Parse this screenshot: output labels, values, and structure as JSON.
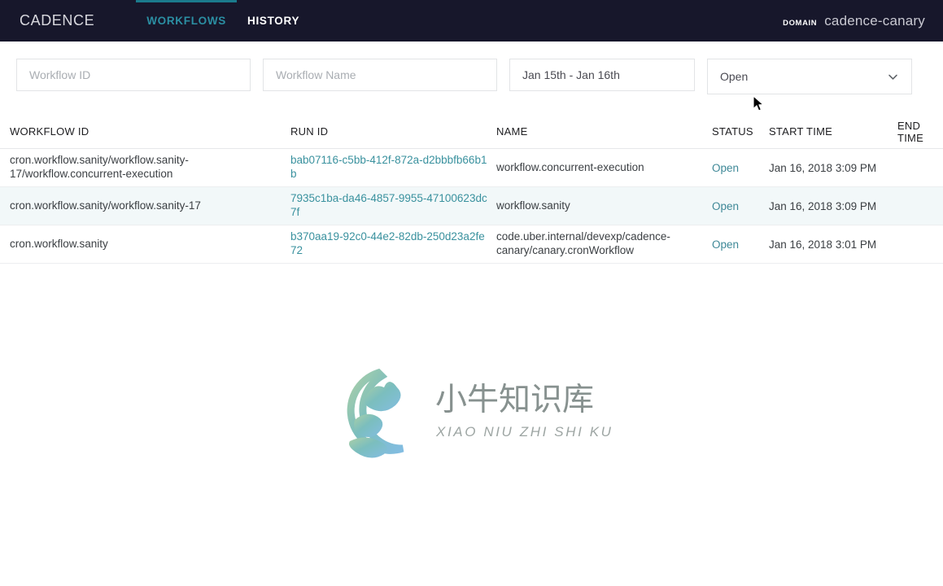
{
  "header": {
    "brand": "CADENCE",
    "tabs": [
      {
        "label": "WORKFLOWS",
        "active": true
      },
      {
        "label": "HISTORY",
        "active": false
      }
    ],
    "domain_label": "DOMAIN",
    "domain_value": "cadence-canary",
    "background_color": "#17172b",
    "active_tab_color": "#2b8fa3"
  },
  "filters": {
    "workflow_id": {
      "value": "",
      "placeholder": "Workflow ID"
    },
    "workflow_name": {
      "value": "",
      "placeholder": "Workflow Name"
    },
    "date_range": {
      "value": "Jan 15th - Jan 16th"
    },
    "status": {
      "value": "Open",
      "icon": "chevron-down-icon"
    }
  },
  "table": {
    "columns": [
      "WORKFLOW ID",
      "RUN ID",
      "NAME",
      "STATUS",
      "START TIME",
      "END\nTIME"
    ],
    "rows": [
      {
        "workflow_id": "cron.workflow.sanity/workflow.sanity-17/workflow.concurrent-execution",
        "run_id": "bab07116-c5bb-412f-872a-d2bbbfb66b1b",
        "name": "workflow.concurrent-execution",
        "status": "Open",
        "start_time": "Jan 16, 2018 3:09 PM",
        "end_time": ""
      },
      {
        "workflow_id": "cron.workflow.sanity/workflow.sanity-17",
        "run_id": "7935c1ba-da46-4857-9955-47100623dc7f",
        "name": "workflow.sanity",
        "status": "Open",
        "start_time": "Jan 16, 2018 3:09 PM",
        "end_time": ""
      },
      {
        "workflow_id": "cron.workflow.sanity",
        "run_id": "b370aa19-92c0-44e2-82db-250d23a2fe72",
        "name": "code.uber.internal/devexp/cadence-canary/canary.cronWorkflow",
        "status": "Open",
        "start_time": "Jan 16, 2018 3:01 PM",
        "end_time": ""
      }
    ],
    "link_color": "#39919e",
    "status_color": "#3e8897",
    "alt_row_color": "#f2f8f9"
  },
  "watermark": {
    "cn_text": "小牛知识库",
    "pinyin_text": "XIAO NIU ZHI SHI KU"
  }
}
